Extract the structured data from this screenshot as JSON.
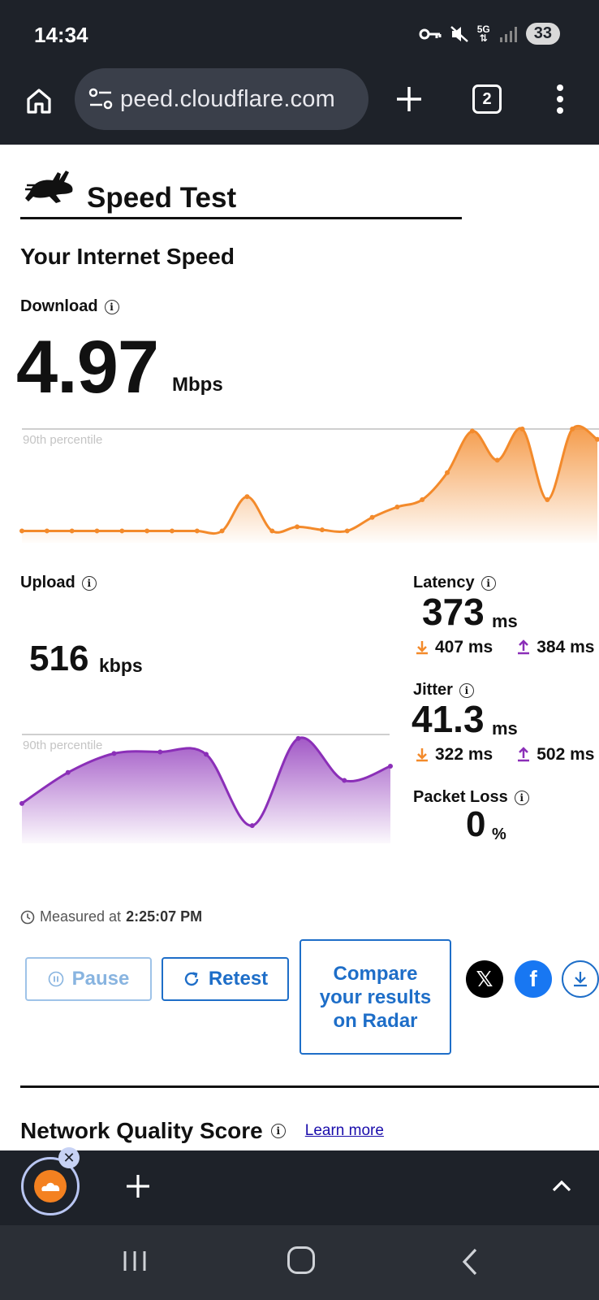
{
  "status_bar": {
    "time": "14:34",
    "network": "5G",
    "battery": "33",
    "icons": [
      "vpn-key-icon",
      "mute-icon",
      "5g-icon",
      "signal-icon",
      "battery-icon"
    ]
  },
  "browser": {
    "url": "peed.cloudflare.com",
    "tab_count": "2",
    "icons": [
      "home-icon",
      "site-settings-icon",
      "new-tab-icon",
      "tabs-icon",
      "menu-icon"
    ]
  },
  "page": {
    "site_title": "Speed Test",
    "section_title": "Your Internet Speed",
    "download": {
      "label": "Download",
      "value": "4.97",
      "unit": "Mbps",
      "chart_label": "90th percentile"
    },
    "upload": {
      "label": "Upload",
      "value": "516",
      "unit": "kbps",
      "chart_label": "90th percentile"
    },
    "latency": {
      "label": "Latency",
      "value": "373",
      "unit": "ms",
      "down": "407 ms",
      "up": "384 ms"
    },
    "jitter": {
      "label": "Jitter",
      "value": "41.3",
      "unit": "ms",
      "down": "322 ms",
      "up": "502 ms"
    },
    "packet_loss": {
      "label": "Packet Loss",
      "value": "0",
      "unit": "%"
    },
    "measured": {
      "prefix": "Measured at",
      "time": "2:25:07 PM"
    },
    "buttons": {
      "pause": "Pause",
      "retest": "Retest",
      "radar": "Compare your results on Radar"
    },
    "network_quality": {
      "title": "Network Quality Score",
      "learn_more": "Learn more"
    },
    "colors": {
      "download": "#f38a2b",
      "upload": "#8b2fb8",
      "link": "#1e6ec8"
    }
  },
  "chart_data": [
    {
      "type": "area",
      "series": [
        {
          "name": "Download",
          "color": "#f38a2b"
        }
      ],
      "points": [
        [
          0,
          0.02
        ],
        [
          1,
          0.02
        ],
        [
          2,
          0.02
        ],
        [
          3,
          0.02
        ],
        [
          4,
          0.02
        ],
        [
          5,
          0.02
        ],
        [
          6,
          0.02
        ],
        [
          7,
          0.02
        ],
        [
          8,
          0.02
        ],
        [
          9,
          0.35
        ],
        [
          10,
          0.02
        ],
        [
          11,
          0.06
        ],
        [
          12,
          0.03
        ],
        [
          13,
          0.02
        ],
        [
          14,
          0.15
        ],
        [
          15,
          0.25
        ],
        [
          16,
          0.32
        ],
        [
          17,
          0.58
        ],
        [
          18,
          0.98
        ],
        [
          19,
          0.7
        ],
        [
          20,
          1.0
        ],
        [
          21,
          0.32
        ],
        [
          22,
          1.0
        ],
        [
          23,
          0.9
        ]
      ],
      "ylim": [
        0,
        1
      ],
      "reference_line": "90th percentile"
    },
    {
      "type": "area",
      "series": [
        {
          "name": "Upload",
          "color": "#8b2fb8"
        }
      ],
      "points": [
        [
          0,
          0.33
        ],
        [
          1,
          0.72
        ],
        [
          2,
          0.96
        ],
        [
          3,
          0.98
        ],
        [
          4,
          0.95
        ],
        [
          5,
          0.05
        ],
        [
          6,
          1.15
        ],
        [
          7,
          0.62
        ],
        [
          8,
          0.8
        ]
      ],
      "ylim": [
        0,
        1.2
      ],
      "reference_line": "90th percentile"
    }
  ]
}
